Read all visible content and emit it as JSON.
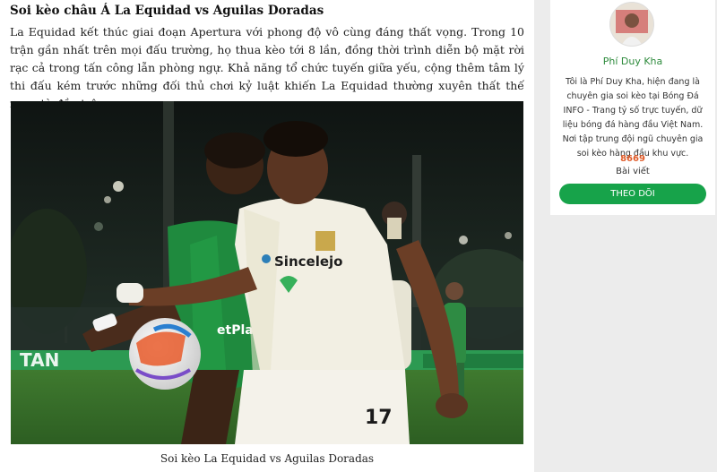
{
  "article": {
    "heading": "Soi kèo châu Á La Equidad vs Aguilas Doradas",
    "paragraph": "La Equidad kết thúc giai đoạn Apertura với phong độ vô cùng đáng thất vọng. Trong 10 trận gần nhất trên mọi đấu trường, họ thua kèo tới 8 lần, đồng thời trình diễn bộ mặt rời rạc cả trong tấn công lẫn phòng ngự. Khả năng tổ chức tuyến giữa yếu, cộng thêm tâm lý thi đấu kém trước những đối thủ chơi kỷ luật khiến La Equidad thường xuyên thất thế ngay từ đầu trận.",
    "image": {
      "sponsor_text": "Sincelejo",
      "shirt_number": "17",
      "opponent_sponsor": "etPlay",
      "board_text": "TAN"
    },
    "caption": "Soi kèo La Equidad vs Aguilas Doradas"
  },
  "sidebar": {
    "author_name": "Phí Duy Kha",
    "bio": "Tôi là Phí Duy Kha, hiện đang là chuyên gia soi kèo tại Bóng Đá INFO - Trang tỷ số trực tuyến, dữ liệu bóng đá hàng đầu Việt Nam. Nơi tập trung đội ngũ chuyên gia soi kèo hàng đầu khu vực.",
    "post_count": "8669",
    "post_label": "Bài viết",
    "follow_label": "THEO DÕI"
  },
  "colors": {
    "accent_green": "#17a34a",
    "count_orange": "#e05c2a"
  }
}
